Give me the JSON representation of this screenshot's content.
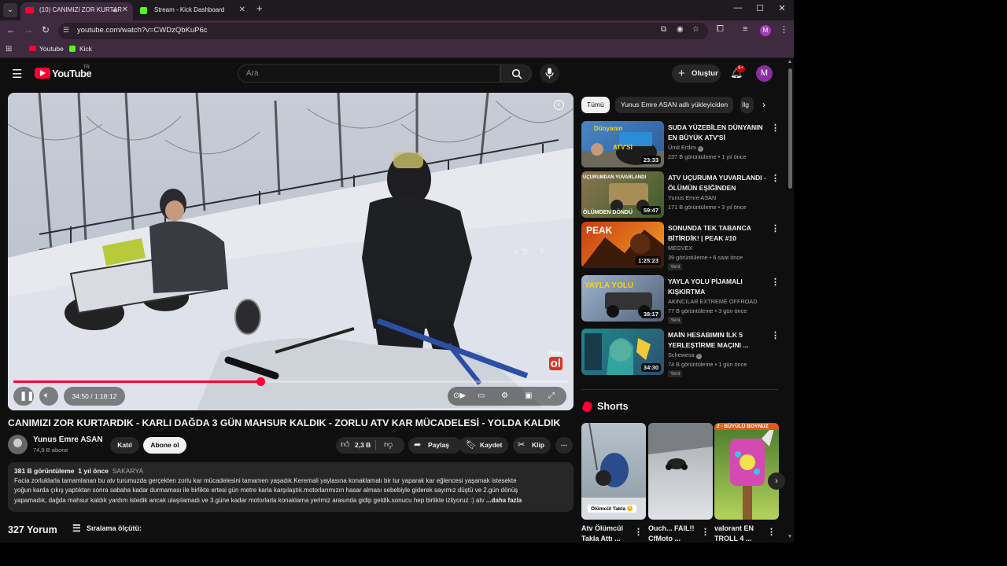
{
  "browser": {
    "tabs": [
      {
        "title": "(10) CANIMIZI ZOR KURTAR",
        "active": true
      },
      {
        "title": "Stream - Kick Dashboard",
        "active": false
      }
    ],
    "url": "youtube.com/watch?v=CWDzQbKuP6c",
    "bookmarks": [
      {
        "label": "Youtube",
        "icon": "youtube-icon"
      },
      {
        "label": "Kick",
        "icon": "kick-icon"
      }
    ],
    "profile_initial": "M"
  },
  "youtube": {
    "logo_text": "YouTube",
    "country_code": "TR",
    "search_placeholder": "Ara",
    "create_label": "Oluştur",
    "notification_badge": "9+",
    "avatar_initial": "M"
  },
  "player": {
    "time_display": "34:50 / 1:18:12",
    "progress_percent": 44.5,
    "skip_label": "+ 5",
    "watermark_top": "Abone",
    "watermark_bottom": "ol"
  },
  "video": {
    "title": "CANIMIZI ZOR KURTARDIK - KARLI DAĞDA 3 GÜN MAHSUR KALDIK - ZORLU ATV KAR MÜCADELESİ - YOLDA KALDIK",
    "channel": "Yunus Emre ASAN",
    "subscribers": "74,9 B abone",
    "join_label": "Katıl",
    "subscribe_label": "Abone ol",
    "likes": "2,3 B",
    "share_label": "Paylaş",
    "save_label": "Kaydet",
    "clip_label": "Klip",
    "views": "381 B görüntüleme",
    "age": "1 yıl önce",
    "location": "SAKARYA",
    "description_lines": [
      "Facia zorluklarla tamamlanan bu atv turumuzda gerçekten zorlu kar mücadelesini tamamen yaşadık.Keremali yaylasına konaklamalı bir tur yaparak kar eğlencesi yaşamak istesekte",
      "yoğun karda çıkış yaptıktan sonra sabaha kadar durmaması ile birlikte ertesi gün metre karla karşılaştık.motorlarımızın hasar alması sebebiyle giderek sayımız düştü ve 2.gün dönüş",
      "yapamadık, dağda mahsur kaldık yardım istedik ancak ulaşılamadı.ve 3.güne kadar motorlarla konaklama yerimiz arasında gidip geldik.sonucu hep birlikte izliyoruz :) atv"
    ],
    "more_label": "...daha fazla",
    "comments_count": "327 Yorum",
    "sort_label": "Sıralama ölçütü:"
  },
  "sidebar": {
    "chips": [
      "Tümü",
      "Yunus Emre ASAN adlı yükleyiciden",
      "İlg"
    ],
    "recommendations": [
      {
        "title": "SUDA YÜZEBİLEN DÜNYANIN EN BÜYÜK ATV'Sİ",
        "channel": "Ümit Erdim",
        "verified": true,
        "meta": "237 B görüntüleme • 1 yıl önce",
        "duration": "23:33",
        "new_badge": ""
      },
      {
        "title": "ATV UÇURUMA YUVARLANDI - ÖLÜMÜN EŞİĞİNDEN DÖNDÜK...",
        "channel": "Yunus Emre ASAN",
        "verified": false,
        "meta": "171 B görüntüleme • 3 yıl önce",
        "duration": "59:47",
        "new_badge": ""
      },
      {
        "title": "SONUNDA TEK TABANCA BİTİRDİK! | PEAK #10",
        "channel": "MEGVEX",
        "verified": false,
        "meta": "39 görüntüleme • 6 saat önce",
        "duration": "1:25:23",
        "new_badge": "Yeni"
      },
      {
        "title": "YAYLA YOLU PİJAMALI KIŞKIRTMA #akıncılarextreme...",
        "channel": "AKINCILAR EXTREME OFFROAD",
        "verified": false,
        "meta": "77 B görüntüleme • 3 gün önce",
        "duration": "38:17",
        "new_badge": "Yeni"
      },
      {
        "title": "MAİN HESABIMIN İLK 5 YERLEŞTİRME MAÇINI ...",
        "channel": "Schewesa",
        "verified": true,
        "meta": "74 B görüntüleme • 1 gün önce",
        "duration": "34:30",
        "new_badge": "Yeni"
      }
    ],
    "thumb_texts": [
      "Dünyanın",
      "ATV'Sİ",
      "UÇURUMDAN YUVARLANDI",
      "ÖLÜMDEN DÖNDÜ",
      "PEAK",
      "YAYLA YOLU"
    ],
    "shorts_heading": "Shorts",
    "shorts": [
      {
        "title": "Atv Ölümcül Takla Attı ...",
        "badge": "Ölümcül Takla 😔"
      },
      {
        "title": "Ouch... FAIL!! CfMoto ...",
        "badge": ""
      },
      {
        "title": "valorant EN TROLL 4 ...",
        "badge": "2 - BÜYÜLÜ BOYNUZ"
      }
    ]
  }
}
